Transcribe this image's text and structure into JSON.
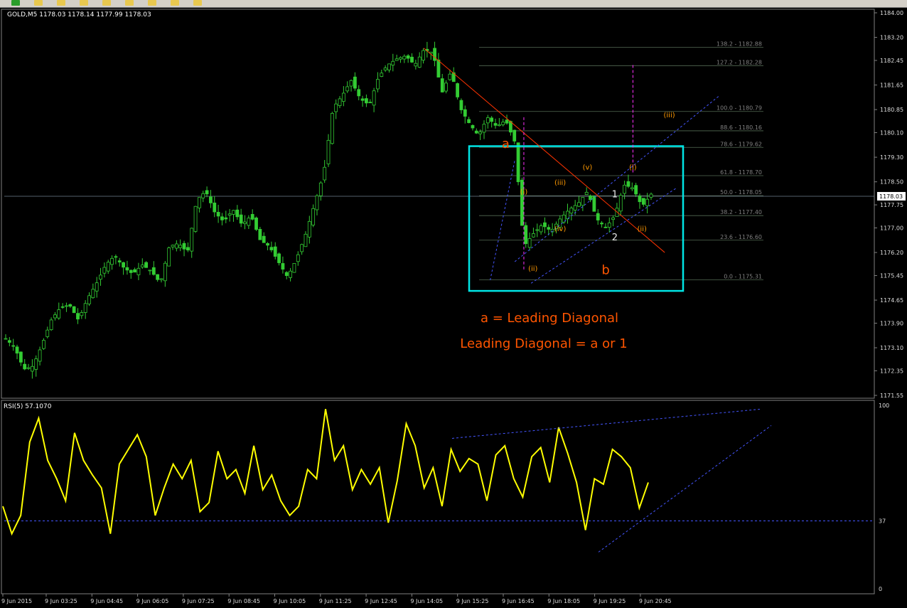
{
  "window": {
    "symbol_header": "GOLD,M5  1178.03 1178.14 1177.99 1178.03",
    "rsi_header": "RSI(5) 57.1070",
    "current_price_label": "1178.03"
  },
  "toolbar": {
    "icons": [
      "add-icon",
      "folder-icon",
      "save-icon",
      "crosshair-icon",
      "line-icon",
      "pencil-icon",
      "text-icon",
      "zoom-in-icon",
      "chart-icon"
    ]
  },
  "colors": {
    "background": "#000000",
    "candle": "#33cc33",
    "grid_line": "#708090",
    "fib_line": "#556b55",
    "fib_text": "#808080",
    "box": "#00e5e5",
    "trendline": "#ff3300",
    "channel": "#4455ff",
    "marker": "#ff2fff",
    "wave_label": "#ff9900",
    "rsi_line": "#ffff00",
    "annotation": "#ff5500",
    "axis_text": "#dddddd"
  },
  "annotations": {
    "line1": "a = Leading Diagonal",
    "line2": "Leading Diagonal = a or 1"
  },
  "chart_data": [
    {
      "type": "candlestick",
      "symbol": "GOLD,M5",
      "ylim": [
        1171.55,
        1184.0
      ],
      "y_ticks": [
        "1184.00",
        "1183.20",
        "1182.45",
        "1181.65",
        "1180.85",
        "1180.10",
        "1179.30",
        "1178.50",
        "1177.75",
        "1177.00",
        "1176.20",
        "1175.45",
        "1174.65",
        "1173.90",
        "1173.10",
        "1172.35",
        "1171.55"
      ],
      "x_ticks": [
        "9 Jun 2015",
        "9 Jun 03:25",
        "9 Jun 04:45",
        "9 Jun 06:05",
        "9 Jun 07:25",
        "9 Jun 08:45",
        "9 Jun 10:05",
        "9 Jun 11:25",
        "9 Jun 12:45",
        "9 Jun 14:05",
        "9 Jun 15:25",
        "9 Jun 16:45",
        "9 Jun 18:05",
        "9 Jun 19:25",
        "9 Jun 20:45"
      ],
      "close_path": [
        [
          0,
          1173.4
        ],
        [
          1,
          1173.1
        ],
        [
          2,
          1172.4
        ],
        [
          3,
          1172.5
        ],
        [
          4,
          1173.2
        ],
        [
          5,
          1174.0
        ],
        [
          6,
          1174.4
        ],
        [
          7,
          1174.5
        ],
        [
          8,
          1174.0
        ],
        [
          9,
          1174.7
        ],
        [
          10,
          1175.2
        ],
        [
          11,
          1175.8
        ],
        [
          12,
          1176.1
        ],
        [
          13,
          1175.7
        ],
        [
          14,
          1175.5
        ],
        [
          15,
          1175.8
        ],
        [
          16,
          1175.6
        ],
        [
          17,
          1175.2
        ],
        [
          18,
          1176.4
        ],
        [
          19,
          1176.5
        ],
        [
          20,
          1176.2
        ],
        [
          21,
          1177.9
        ],
        [
          22,
          1178.2
        ],
        [
          23,
          1177.5
        ],
        [
          24,
          1177.2
        ],
        [
          25,
          1177.6
        ],
        [
          26,
          1177.1
        ],
        [
          27,
          1177.4
        ],
        [
          28,
          1176.6
        ],
        [
          29,
          1176.4
        ],
        [
          30,
          1175.9
        ],
        [
          31,
          1175.4
        ],
        [
          32,
          1176.0
        ],
        [
          33,
          1176.8
        ],
        [
          34,
          1177.8
        ],
        [
          35,
          1178.8
        ],
        [
          36,
          1180.9
        ],
        [
          37,
          1181.3
        ],
        [
          38,
          1181.8
        ],
        [
          39,
          1181.2
        ],
        [
          40,
          1181.0
        ],
        [
          41,
          1181.9
        ],
        [
          42,
          1182.3
        ],
        [
          43,
          1182.5
        ],
        [
          44,
          1182.6
        ],
        [
          45,
          1182.3
        ],
        [
          46,
          1182.8
        ],
        [
          47,
          1182.7
        ],
        [
          48,
          1181.4
        ],
        [
          49,
          1182.1
        ],
        [
          50,
          1180.9
        ],
        [
          51,
          1180.4
        ],
        [
          52,
          1180.0
        ],
        [
          53,
          1180.6
        ],
        [
          54,
          1180.3
        ],
        [
          55,
          1180.5
        ],
        [
          56,
          1179.8
        ],
        [
          57,
          1176.4
        ],
        [
          58,
          1176.8
        ],
        [
          59,
          1177.1
        ],
        [
          60,
          1176.9
        ],
        [
          61,
          1177.3
        ],
        [
          62,
          1177.6
        ],
        [
          63,
          1177.8
        ],
        [
          64,
          1178.2
        ],
        [
          65,
          1177.3
        ],
        [
          66,
          1177.0
        ],
        [
          67,
          1177.4
        ],
        [
          68,
          1178.4
        ],
        [
          69,
          1178.3
        ],
        [
          70,
          1177.7
        ],
        [
          71,
          1178.1
        ]
      ],
      "fibonacci": [
        {
          "label": "138.2 - 1182.88",
          "value": 1182.88
        },
        {
          "label": "127.2 - 1182.28",
          "value": 1182.28
        },
        {
          "label": "100.0 - 1180.79",
          "value": 1180.79
        },
        {
          "label": "88.6 - 1180.16",
          "value": 1180.16
        },
        {
          "label": "78.6 - 1179.62",
          "value": 1179.62
        },
        {
          "label": "61.8 - 1178.70",
          "value": 1178.7
        },
        {
          "label": "50.0 - 1178.05",
          "value": 1178.05
        },
        {
          "label": "38.2 - 1177.40",
          "value": 1177.4
        },
        {
          "label": "23.6 - 1176.60",
          "value": 1176.6
        },
        {
          "label": "0.0 - 1175.31",
          "value": 1175.31
        }
      ],
      "wave_labels": [
        {
          "text": "a",
          "index": 55,
          "value": 1179.6
        },
        {
          "text": "(i)",
          "index": 57,
          "value": 1178.1
        },
        {
          "text": "(ii)",
          "index": 58,
          "value": 1175.6
        },
        {
          "text": "(iii)",
          "index": 61,
          "value": 1178.4
        },
        {
          "text": "(iv)",
          "index": 61,
          "value": 1176.9
        },
        {
          "text": "(v)",
          "index": 64,
          "value": 1178.9
        },
        {
          "text": "1",
          "index": 67,
          "value": 1178.0
        },
        {
          "text": "2",
          "index": 67,
          "value": 1176.6
        },
        {
          "text": "b",
          "index": 66,
          "value": 1175.5
        },
        {
          "text": "(i)",
          "index": 69,
          "value": 1178.9
        },
        {
          "text": "(ii)",
          "index": 70,
          "value": 1176.9
        },
        {
          "text": "(iii)",
          "index": 73,
          "value": 1180.6
        }
      ]
    },
    {
      "type": "line",
      "name": "RSI(5)",
      "ylim": [
        0,
        100
      ],
      "y_ticks": [
        "100",
        "37",
        "0"
      ],
      "level": 37,
      "last_value": 57.107,
      "values": [
        45,
        30,
        40,
        80,
        93,
        70,
        60,
        48,
        85,
        70,
        62,
        55,
        30,
        68,
        76,
        84,
        72,
        40,
        55,
        68,
        60,
        70,
        42,
        47,
        75,
        60,
        65,
        52,
        78,
        54,
        62,
        48,
        40,
        45,
        65,
        60,
        98,
        70,
        78,
        54,
        65,
        57,
        66,
        36,
        59,
        90,
        78,
        55,
        66,
        45,
        76,
        64,
        71,
        68,
        48,
        73,
        78,
        60,
        50,
        72,
        77,
        58,
        88,
        74,
        58,
        32,
        60,
        57,
        76,
        72,
        66,
        44,
        58
      ]
    }
  ]
}
